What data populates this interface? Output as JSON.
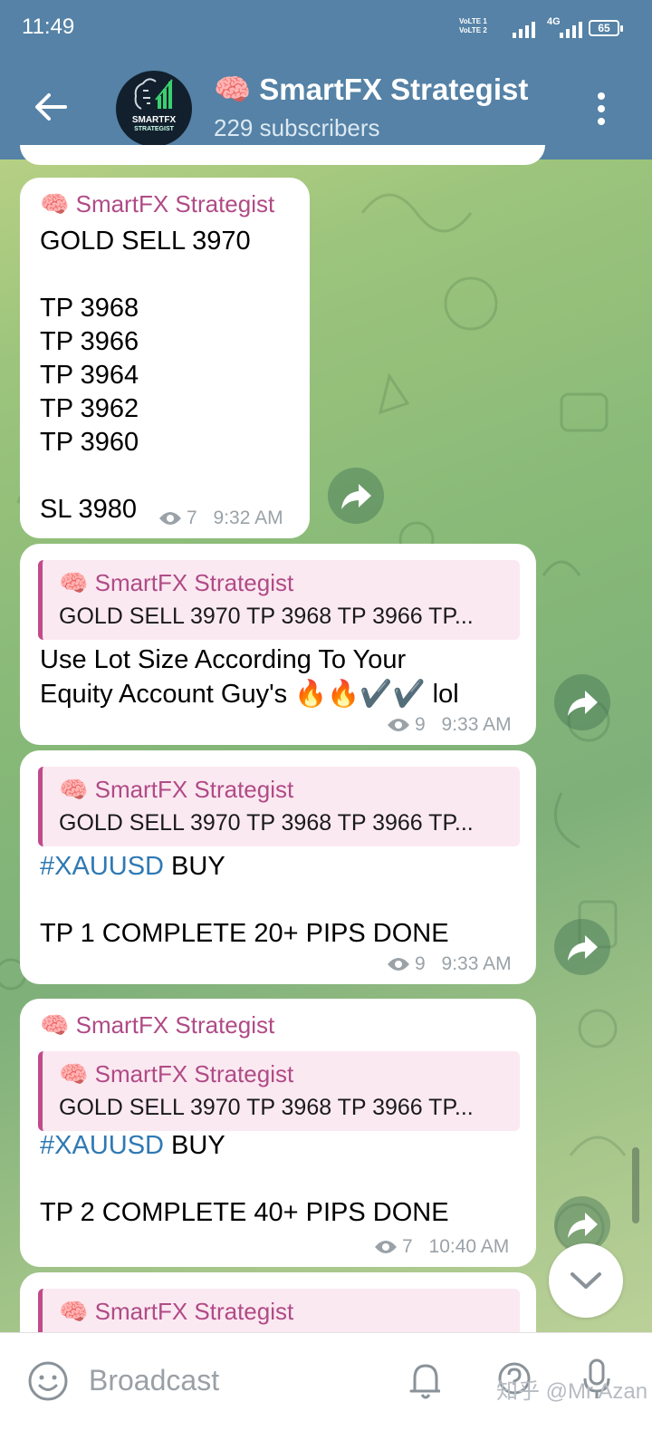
{
  "status_bar": {
    "time": "11:49",
    "volte_1": "VoLTE 1",
    "volte_2": "VoLTE 2",
    "network": "4G",
    "battery": "65"
  },
  "header": {
    "channel_name": "🧠 SmartFX Strategist",
    "subscribers": "229 subscribers",
    "avatar_line1": "SMARTFX",
    "avatar_line2": "STRATEGIST"
  },
  "messages": [
    {
      "author": "🧠 SmartFX Strategist",
      "lines": [
        "GOLD SELL 3970",
        "TP 3968",
        "TP 3966",
        "TP 3964",
        "TP 3962",
        "TP 3960",
        "SL 3980"
      ],
      "views": "7",
      "time": "9:32 AM"
    },
    {
      "reply_author": "🧠 SmartFX Strategist",
      "reply_text": "GOLD SELL 3970  TP 3968 TP 3966 TP...",
      "lines": [
        "Use Lot Size According To Your",
        "Equity Account Guy's 🔥🔥✔️✔️ lol"
      ],
      "views": "9",
      "time": "9:33 AM"
    },
    {
      "reply_author": "🧠 SmartFX Strategist",
      "reply_text": "GOLD SELL 3970  TP 3968 TP 3966 TP...",
      "hashtag": "#XAUUSD",
      "hashtag_suffix": " BUY",
      "lines": [
        "TP 1 COMPLETE   20+ PIPS DONE"
      ],
      "views": "9",
      "time": "9:33 AM"
    },
    {
      "author": "🧠 SmartFX Strategist",
      "reply_author": "🧠 SmartFX Strategist",
      "reply_text": "GOLD SELL 3970  TP 3968 TP 3966 TP...",
      "hashtag": "#XAUUSD",
      "hashtag_suffix": " BUY",
      "lines": [
        "TP 2 COMPLETE   40+ PIPS DONE"
      ],
      "views": "7",
      "time": "10:40 AM"
    },
    {
      "reply_author": "🧠 SmartFX Strategist"
    }
  ],
  "bottom_bar": {
    "placeholder": "Broadcast",
    "watermark": "知乎 @Mr Azan"
  },
  "colors": {
    "header_bg": "#5582a6",
    "author_color": "#b04b86",
    "hashtag_color": "#2f79b3",
    "quote_bg": "#fbe9f1"
  }
}
